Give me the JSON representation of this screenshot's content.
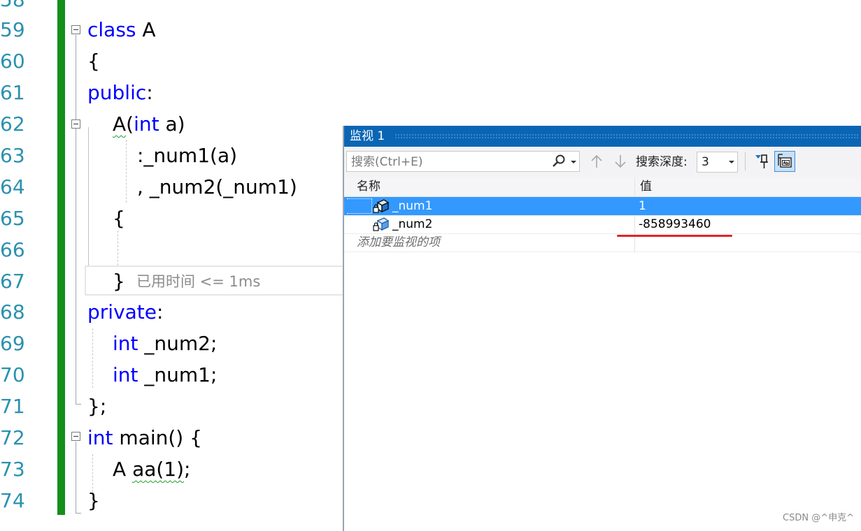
{
  "editor": {
    "line_numbers": [
      "58",
      "59",
      "60",
      "61",
      "62",
      "63",
      "64",
      "65",
      "66",
      "67",
      "68",
      "69",
      "70",
      "71",
      "72",
      "73",
      "74"
    ],
    "lines": {
      "l59_kw": "class",
      "l59_rest": " A",
      "l60": "{",
      "l61_kw": "public",
      "l61_rest": ":",
      "l62_a": "A",
      "l62_b": "(",
      "l62_kw": "int",
      "l62_rest": " a)",
      "l63": ":_num1(a)",
      "l64": ", _num2(_num1)",
      "l65": "{",
      "l67": "}",
      "l68_kw": "private",
      "l68_rest": ":",
      "l69_kw": "int",
      "l69_rest": " _num2;",
      "l70_kw": "int",
      "l70_rest": " _num1;",
      "l71": "};",
      "l72_kw": "int",
      "l72_rest": " main() {",
      "l73_a": "A ",
      "l73_b": "aa(1)",
      "l73_c": ";",
      "l74": "}"
    },
    "elapsed_hint": "已用时间 <= 1ms"
  },
  "watch": {
    "title": "监视 1",
    "search_placeholder": "搜索(Ctrl+E)",
    "depth_label": "搜索深度:",
    "depth_value": "3",
    "columns": {
      "name": "名称",
      "value": "值"
    },
    "rows": [
      {
        "name": "_num1",
        "value": "1",
        "selected": true
      },
      {
        "name": "_num2",
        "value": "-858993460",
        "selected": false
      }
    ],
    "add_item": "添加要监视的项"
  },
  "watermark": "CSDN @^申克^",
  "colors": {
    "keyword": "#0000ff",
    "line_number": "#2b91af",
    "change_bar": "#148f1a",
    "selection": "#3399ff",
    "title_bar": "#0a66b5",
    "highlight_underline": "#e1242b"
  }
}
